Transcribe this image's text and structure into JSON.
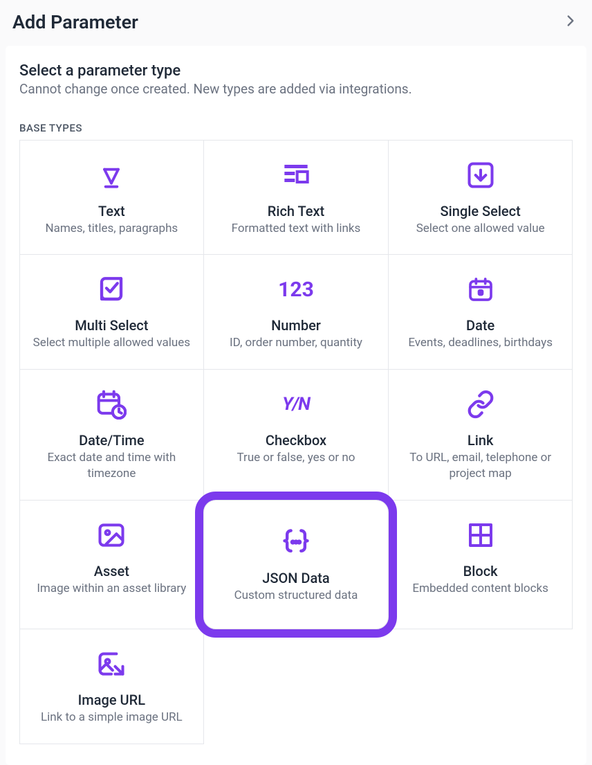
{
  "header": {
    "title": "Add Parameter"
  },
  "intro": {
    "title": "Select a parameter type",
    "description": "Cannot change once created. New types are added via integrations."
  },
  "section_label": "BASE TYPES",
  "types": [
    {
      "key": "text",
      "title": "Text",
      "desc": "Names, titles, paragraphs"
    },
    {
      "key": "rich-text",
      "title": "Rich Text",
      "desc": "Formatted text with links"
    },
    {
      "key": "single-select",
      "title": "Single Select",
      "desc": "Select one allowed value"
    },
    {
      "key": "multi-select",
      "title": "Multi Select",
      "desc": "Select multiple allowed values"
    },
    {
      "key": "number",
      "title": "Number",
      "desc": "ID, order number, quantity"
    },
    {
      "key": "date",
      "title": "Date",
      "desc": "Events, deadlines, birthdays"
    },
    {
      "key": "datetime",
      "title": "Date/Time",
      "desc": "Exact date and time with timezone"
    },
    {
      "key": "checkbox",
      "title": "Checkbox",
      "desc": "True or false, yes or no"
    },
    {
      "key": "link",
      "title": "Link",
      "desc": "To URL, email, telephone or project map"
    },
    {
      "key": "asset",
      "title": "Asset",
      "desc": "Image within an asset library"
    },
    {
      "key": "json-data",
      "title": "JSON Data",
      "desc": "Custom structured data"
    },
    {
      "key": "block",
      "title": "Block",
      "desc": "Embedded content blocks"
    },
    {
      "key": "image-url",
      "title": "Image URL",
      "desc": "Link to a simple image URL"
    }
  ],
  "accent_color": "#7c3aed",
  "highlighted_type": "json-data"
}
